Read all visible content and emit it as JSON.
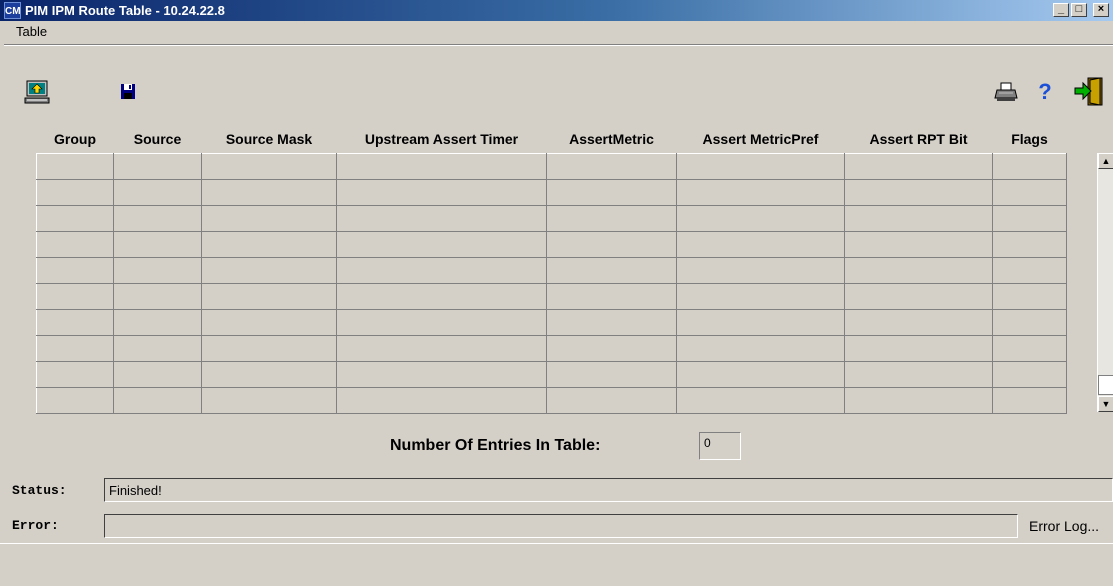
{
  "window": {
    "title": "PIM IPM Route Table - 10.24.22.8",
    "app_icon_text": "CM",
    "minimize_glyph": "_",
    "maximize_glyph": "□",
    "close_glyph": "×"
  },
  "menu": {
    "items": [
      "Table"
    ]
  },
  "toolbar": {
    "left_icons": [
      "retrieve-icon",
      "save-icon"
    ],
    "right_icons": [
      "print-icon",
      "help-icon",
      "exit-icon"
    ],
    "help_glyph": "?"
  },
  "table": {
    "columns": [
      "Group",
      "Source",
      "Source Mask",
      "Upstream Assert Timer",
      "AssertMetric",
      "Assert MetricPref",
      "Assert RPT Bit",
      "Flags"
    ],
    "rows": [
      [
        "",
        "",
        "",
        "",
        "",
        "",
        "",
        ""
      ],
      [
        "",
        "",
        "",
        "",
        "",
        "",
        "",
        ""
      ],
      [
        "",
        "",
        "",
        "",
        "",
        "",
        "",
        ""
      ],
      [
        "",
        "",
        "",
        "",
        "",
        "",
        "",
        ""
      ],
      [
        "",
        "",
        "",
        "",
        "",
        "",
        "",
        ""
      ],
      [
        "",
        "",
        "",
        "",
        "",
        "",
        "",
        ""
      ],
      [
        "",
        "",
        "",
        "",
        "",
        "",
        "",
        ""
      ],
      [
        "",
        "",
        "",
        "",
        "",
        "",
        "",
        ""
      ],
      [
        "",
        "",
        "",
        "",
        "",
        "",
        "",
        ""
      ],
      [
        "",
        "",
        "",
        "",
        "",
        "",
        "",
        ""
      ]
    ]
  },
  "entries": {
    "label": "Number Of Entries In Table:",
    "value": "0"
  },
  "status": {
    "label": "Status:",
    "value": "Finished!"
  },
  "error": {
    "label": "Error:",
    "value": "",
    "log_link": "Error Log..."
  },
  "colors": {
    "titlebar_start": "#0a246a",
    "titlebar_end": "#a6caf0",
    "face": "#d4d0c8"
  }
}
